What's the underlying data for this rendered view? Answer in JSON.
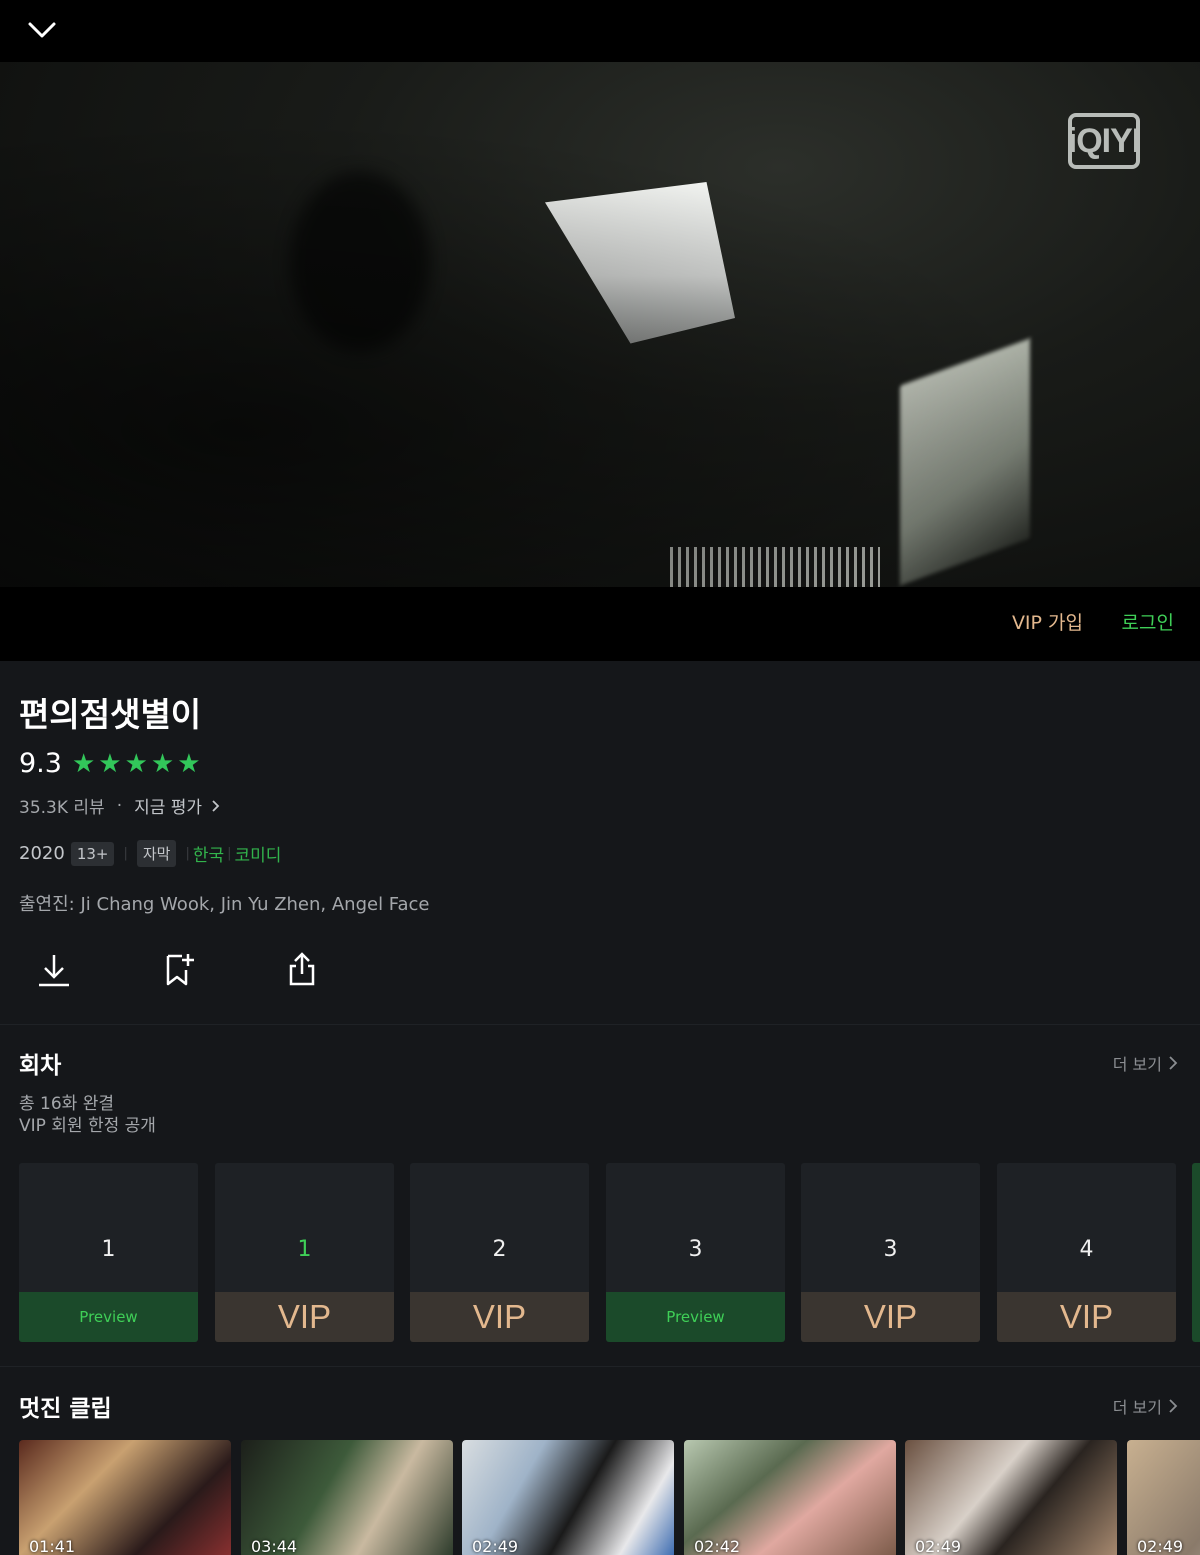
{
  "player": {
    "logo_text": "iQIYI",
    "vip_join_label": "VIP 가입",
    "login_label": "로그인"
  },
  "show": {
    "title": "편의점샛별이",
    "score": "9.3",
    "stars": 5,
    "reviews": "35.3K 리뷰",
    "separator": "·",
    "rate_now": "지금 평가",
    "year": "2020",
    "age_rating": "13+",
    "subtitle_tag": "자막",
    "country": "한국",
    "genre": "코미디",
    "cast": "출연진: Ji Chang Wook, Jin Yu Zhen, Angel Face"
  },
  "actions": [
    "download-icon",
    "bookmark-add-icon",
    "share-icon"
  ],
  "episodes_section": {
    "title": "회차",
    "more_label": "더 보기",
    "total": "총 16화 완결",
    "note": "VIP 회원 한정 공개",
    "items": [
      {
        "number": "1",
        "badge": "Preview",
        "type": "preview",
        "active": false
      },
      {
        "number": "1",
        "badge": "VIP",
        "type": "vip",
        "active": true
      },
      {
        "number": "2",
        "badge": "VIP",
        "type": "vip",
        "active": false
      },
      {
        "number": "3",
        "badge": "Preview",
        "type": "preview",
        "active": false
      },
      {
        "number": "3",
        "badge": "VIP",
        "type": "vip",
        "active": false
      },
      {
        "number": "4",
        "badge": "VIP",
        "type": "vip",
        "active": false
      }
    ]
  },
  "clips_section": {
    "title": "멋진 클립",
    "more_label": "더 보기",
    "items": [
      {
        "duration": "01:41"
      },
      {
        "duration": "03:44"
      },
      {
        "duration": "02:49"
      },
      {
        "duration": "02:42"
      },
      {
        "duration": "02:49"
      },
      {
        "duration": "02:49"
      }
    ]
  },
  "colors": {
    "accent_green": "#3fcf57",
    "vip_gold": "#e3b88e",
    "background": "#15171a"
  }
}
